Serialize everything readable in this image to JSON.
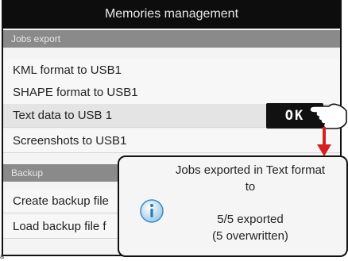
{
  "title": "Memories management",
  "sections": [
    {
      "label": "Jobs export"
    },
    {
      "label": "Backup"
    }
  ],
  "jobs_items": [
    {
      "label": "KML format to USB1"
    },
    {
      "label": "SHAPE format to USB1"
    },
    {
      "label": "Text data to USB 1"
    },
    {
      "label": "Screenshots to USB1"
    }
  ],
  "backup_items": [
    {
      "label": "Create backup file"
    },
    {
      "label": "Load backup file f"
    }
  ],
  "ok_button": {
    "label": "OK"
  },
  "dialog": {
    "line1": "Jobs exported in Text format",
    "line2": "to",
    "line3": "5/5 exported",
    "line4": "(5 overwritten)",
    "icon": "info-icon"
  },
  "annotation": {
    "hand": "pointing-hand-icon",
    "arrow": "red-arrow",
    "arrow_color": "#d42020"
  },
  "corner_label": "a"
}
